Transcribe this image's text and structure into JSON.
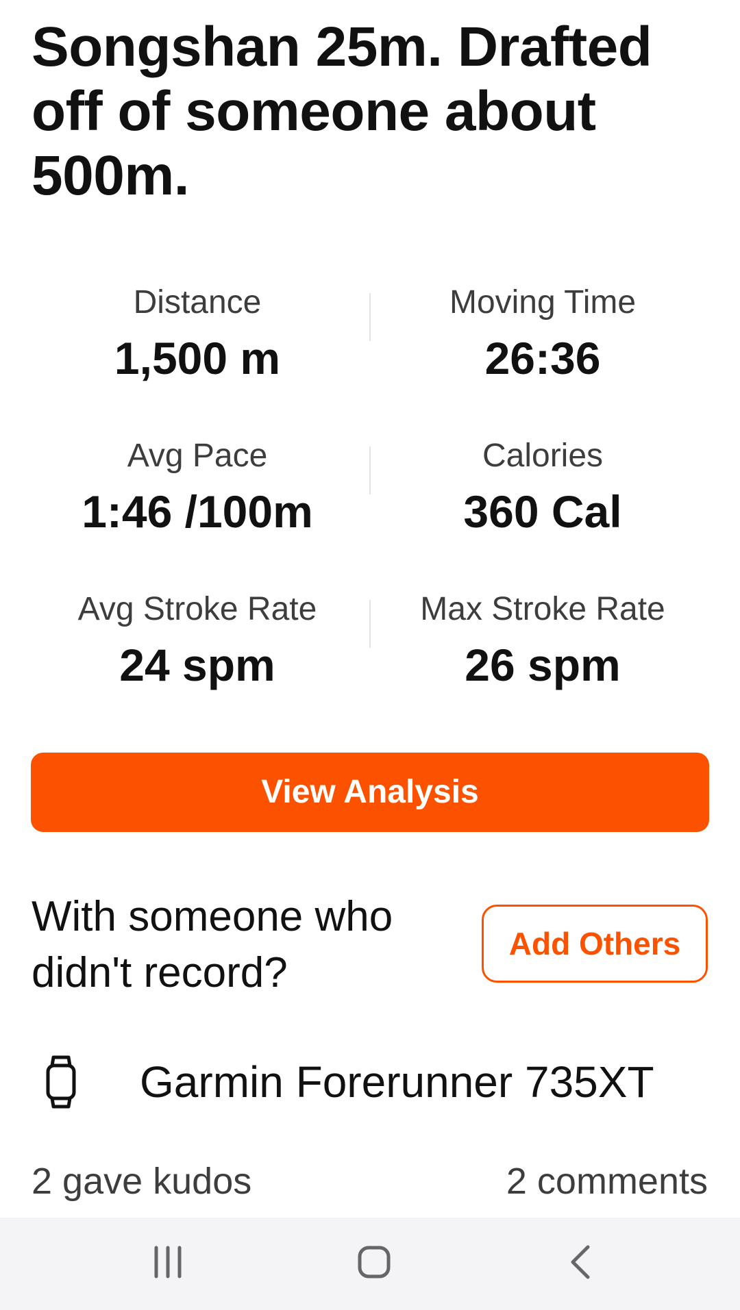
{
  "activity": {
    "title": "Songshan 25m. Drafted off of someone about 500m."
  },
  "stats": [
    {
      "label": "Distance",
      "value": "1,500 m"
    },
    {
      "label": "Moving Time",
      "value": "26:36"
    },
    {
      "label": "Avg Pace",
      "value": "1:46 /100m"
    },
    {
      "label": "Calories",
      "value": "360 Cal"
    },
    {
      "label": "Avg Stroke Rate",
      "value": "24 spm"
    },
    {
      "label": "Max Stroke Rate",
      "value": "26 spm"
    }
  ],
  "actions": {
    "view_analysis_label": "View Analysis",
    "with_others_prompt": "With someone who didn't record?",
    "add_others_label": "Add Others"
  },
  "device": {
    "icon": "watch-icon",
    "name": "Garmin Forerunner 735XT"
  },
  "social": {
    "kudos_text": "2 gave kudos",
    "comments_text": "2 comments"
  },
  "navbar": {
    "icons": [
      "recent-apps-icon",
      "home-icon",
      "back-icon"
    ]
  },
  "colors": {
    "accent": "#fc5200",
    "text": "#111111",
    "secondary_text": "#3d3d3d",
    "navbar_bg": "#f4f4f6"
  }
}
